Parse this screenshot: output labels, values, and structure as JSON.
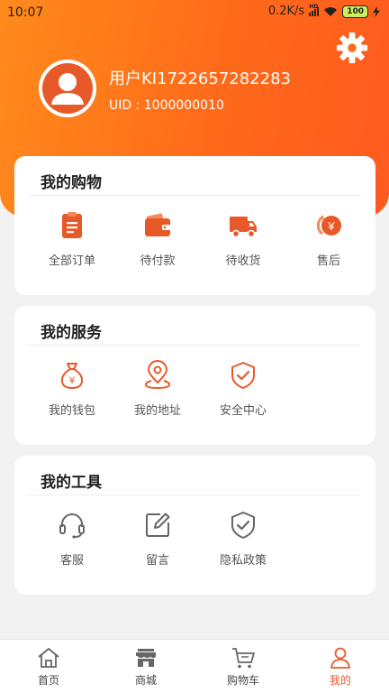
{
  "status_bar": {
    "time": "10:07",
    "network_speed": "0.2K/s",
    "network_badge": "HD",
    "battery": "100"
  },
  "profile": {
    "username": "用户KI1722657282283",
    "uid": "UID : 1000000010"
  },
  "shopping": {
    "title": "我的购物",
    "items": [
      {
        "label": "全部订单",
        "icon": "order-list-icon"
      },
      {
        "label": "待付款",
        "icon": "wallet-icon"
      },
      {
        "label": "待收货",
        "icon": "truck-icon"
      },
      {
        "label": "售后",
        "icon": "refund-icon"
      }
    ]
  },
  "services": {
    "title": "我的服务",
    "items": [
      {
        "label": "我的钱包",
        "icon": "money-bag-icon"
      },
      {
        "label": "我的地址",
        "icon": "location-pin-icon"
      },
      {
        "label": "安全中心",
        "icon": "shield-check-icon"
      }
    ]
  },
  "tools": {
    "title": "我的工具",
    "items": [
      {
        "label": "客服",
        "icon": "headset-icon"
      },
      {
        "label": "留言",
        "icon": "edit-icon"
      },
      {
        "label": "隐私政策",
        "icon": "privacy-shield-icon"
      }
    ]
  },
  "tabbar": {
    "items": [
      {
        "label": "首页",
        "icon": "home-icon"
      },
      {
        "label": "商城",
        "icon": "store-icon"
      },
      {
        "label": "购物车",
        "icon": "cart-icon"
      },
      {
        "label": "我的",
        "icon": "user-icon",
        "active": true
      }
    ]
  },
  "colors": {
    "accent": "#e8592a",
    "header_start": "#ff8a1c",
    "header_end": "#ff5a1f"
  }
}
